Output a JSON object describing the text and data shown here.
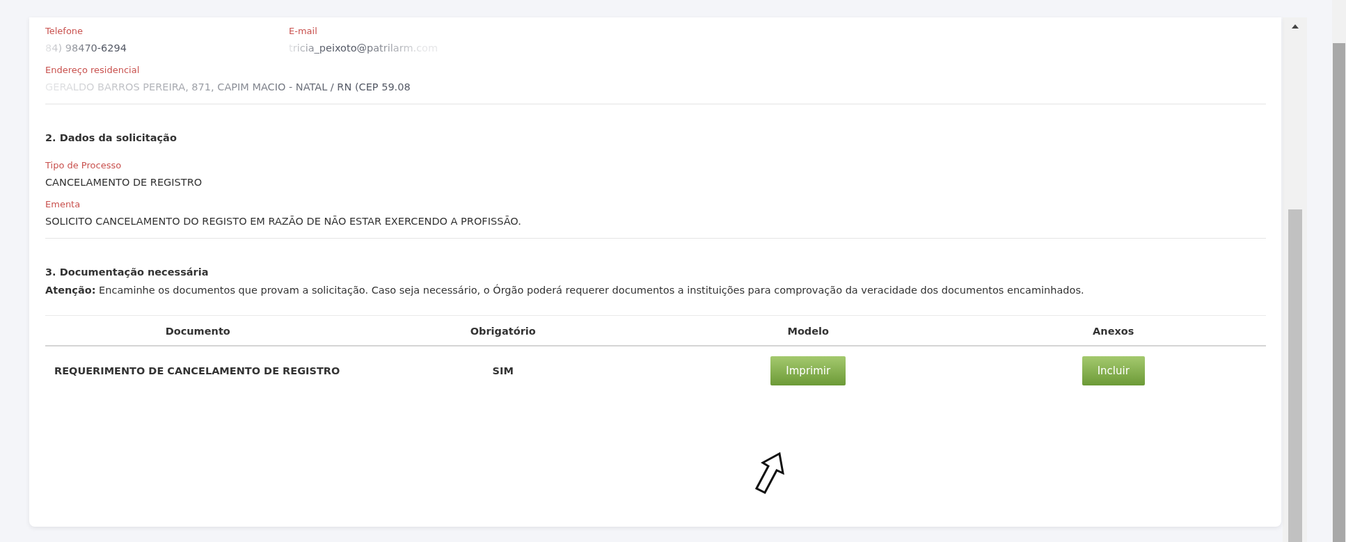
{
  "contact": {
    "fields": [
      {
        "label": "Telefone",
        "value": "84) 98470-6294"
      },
      {
        "label": "E-mail",
        "value": "tricia_peixoto@patrilarm.com"
      }
    ],
    "address": {
      "label": "Endereço residencial",
      "value": "GERALDO BARROS PEREIRA, 871, CAPIM MACIO - NATAL / RN (CEP 59.08"
    }
  },
  "request": {
    "title": "2. Dados da solicitação",
    "fields": [
      {
        "label": "Tipo de Processo",
        "value": "CANCELAMENTO DE REGISTRO"
      },
      {
        "label": "Ementa",
        "value": "SOLICITO CANCELAMENTO DO REGISTO EM RAZÃO DE NÃO ESTAR EXERCENDO A PROFISSÃO."
      }
    ]
  },
  "documents": {
    "title": "3. Documentação necessária",
    "notice": "**Atenção:** Encaminhe os documentos que provam a solicitação. Caso seja necessário, o Órgão poderá requerer documentos a instituições para comprovação da veracidade dos documentos encaminhados.",
    "columns": [
      "Documento",
      "Obrigatório",
      "Modelo",
      "Anexos"
    ],
    "rows": [
      {
        "document": "REQUERIMENTO DE CANCELAMENTO DE REGISTRO",
        "required": "SIM",
        "model_button": "Imprimir",
        "attach_button": "Incluir"
      }
    ]
  }
}
